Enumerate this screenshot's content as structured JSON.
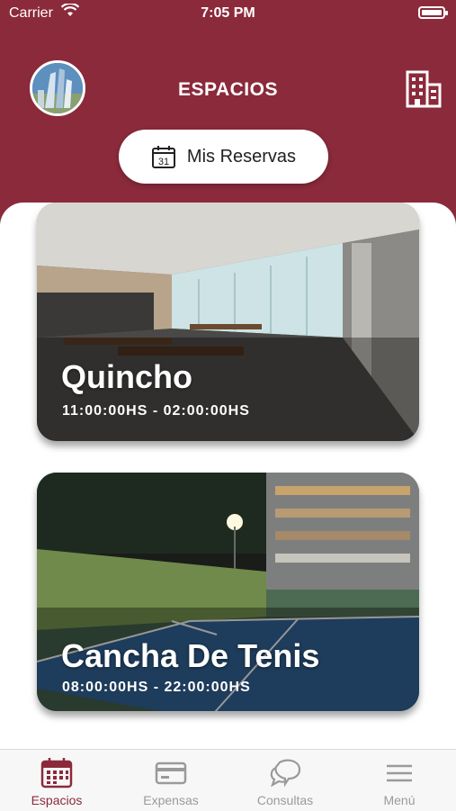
{
  "status_bar": {
    "carrier": "Carrier",
    "time": "7:05 PM"
  },
  "header": {
    "title": "ESPACIOS",
    "reservas_label": "Mis Reservas",
    "calendar_day": "31"
  },
  "spaces": [
    {
      "name": "Quincho",
      "hours": "11:00:00HS - 02:00:00HS"
    },
    {
      "name": "Cancha De Tenis",
      "hours": "08:00:00HS - 22:00:00HS"
    }
  ],
  "tabs": [
    {
      "label": "Espacios",
      "icon": "calendar-icon",
      "active": true
    },
    {
      "label": "Expensas",
      "icon": "credit-card-icon",
      "active": false
    },
    {
      "label": "Consultas",
      "icon": "chat-bubbles-icon",
      "active": false
    },
    {
      "label": "Menú",
      "icon": "hamburger-icon",
      "active": false
    }
  ],
  "colors": {
    "brand": "#8b2a3b",
    "inactive": "#9a9a9a"
  }
}
